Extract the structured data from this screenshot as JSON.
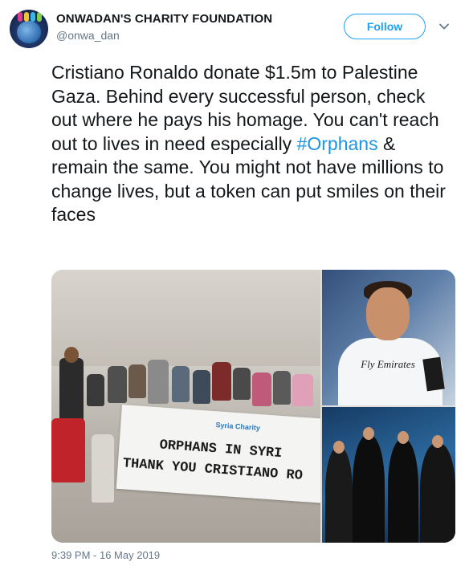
{
  "account": {
    "display_name": "ONWADAN'S CHARITY FOUNDATION",
    "handle": "@onwa_dan",
    "avatar_icon": "charity-globe-logo"
  },
  "follow_button": {
    "label": "Follow",
    "color": "#1da1f2"
  },
  "menu": {
    "icon": "chevron-down-icon"
  },
  "tweet": {
    "text_before": "Cristiano Ronaldo donate $1.5m to Palestine Gaza. Behind every successful person, check out where he pays his homage. You can't reach out to lives in need especially ",
    "hashtag": "#Orphans",
    "text_after": " & remain the same. You might not have millions to change lives, but a token can put smiles on their faces",
    "hashtag_color": "#1b95e0",
    "timestamp": "9:39 PM - 16 May 2019"
  },
  "media": {
    "photo1": {
      "banner_logo": "Syria Charity",
      "banner_line1": "ORPHANS IN SYRI",
      "banner_line2": "THANK YOU CRISTIANO RO"
    },
    "photo2": {
      "sponsor": "Fly Emirates"
    },
    "photo3": {}
  }
}
